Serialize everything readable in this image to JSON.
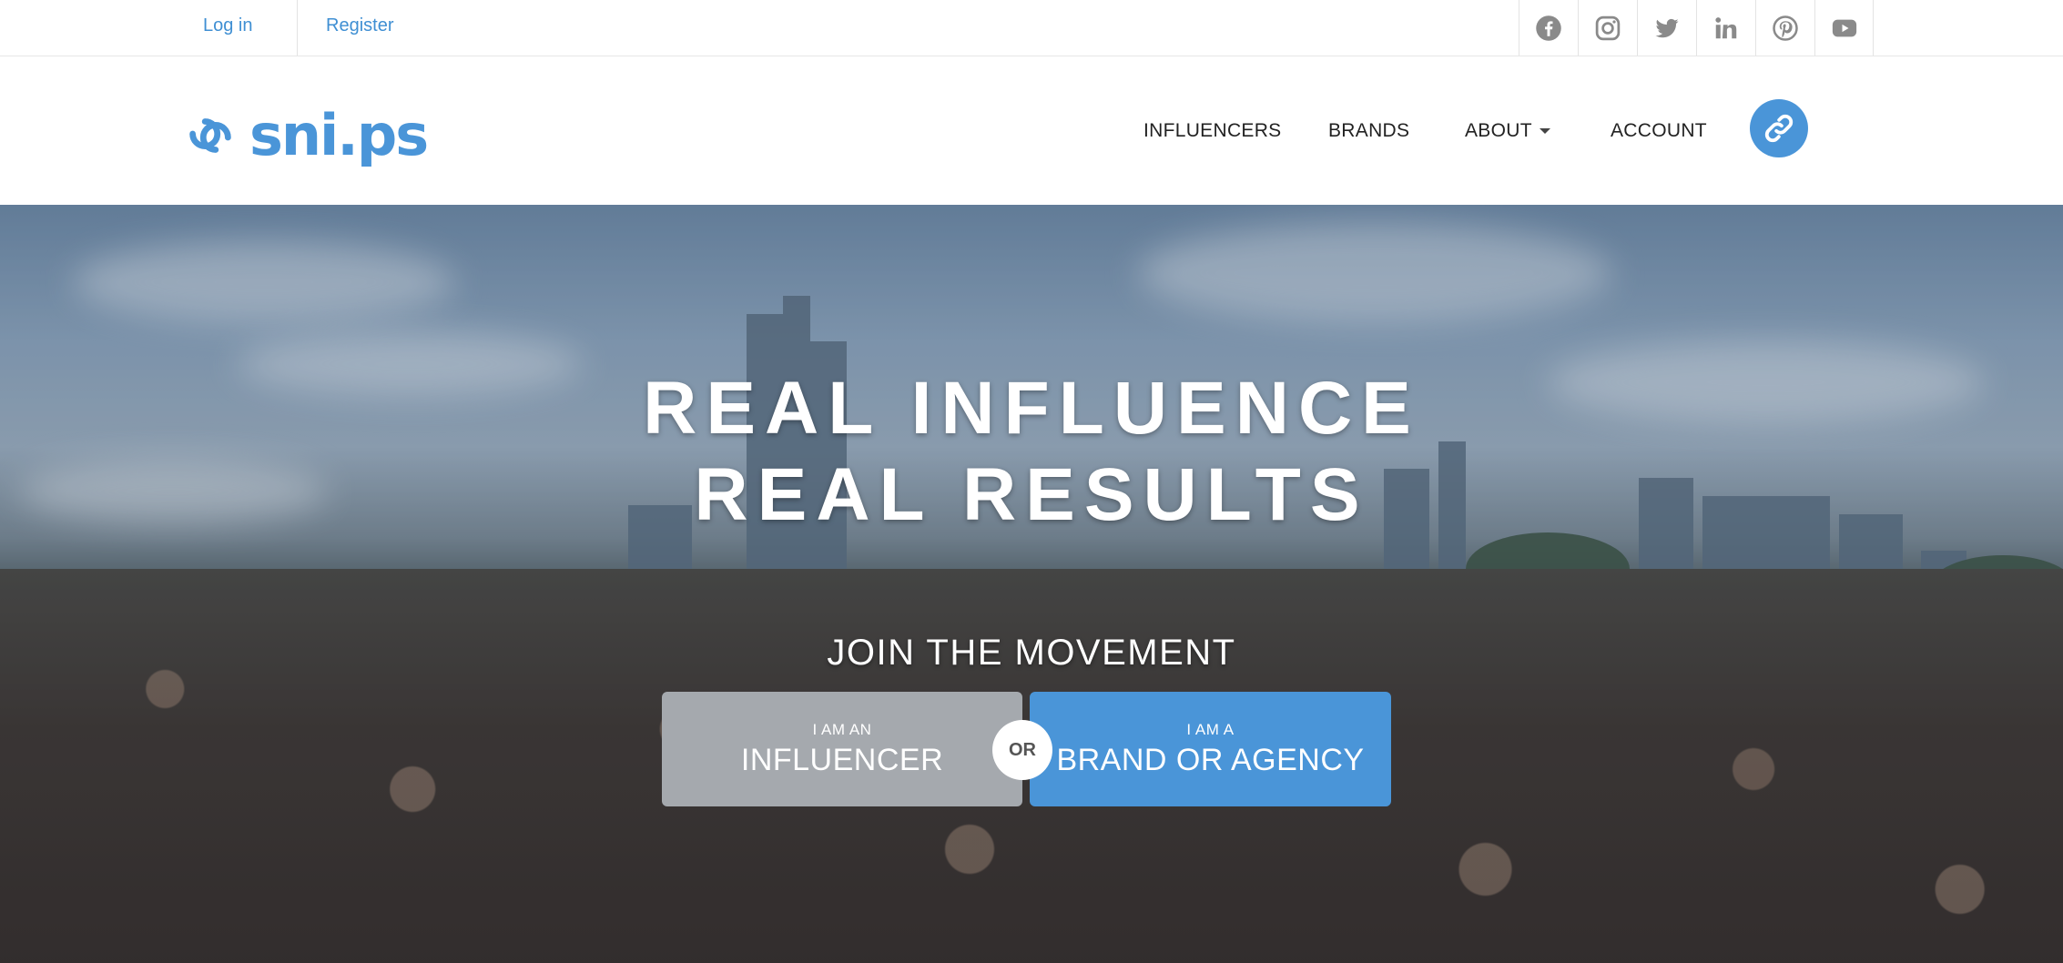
{
  "topbar": {
    "login_label": "Log in",
    "register_label": "Register",
    "social_icons": [
      "facebook-icon",
      "instagram-icon",
      "twitter-icon",
      "linkedin-icon",
      "pinterest-icon",
      "youtube-icon"
    ],
    "icon_color": "#8a8a8a"
  },
  "header": {
    "logo_text": "sni.ps",
    "brand_color": "#4a95d8",
    "nav": {
      "influencers": "INFLUENCERS",
      "brands": "BRANDS",
      "about": "ABOUT",
      "account": "ACCOUNT"
    },
    "cta_icon": "link-icon"
  },
  "hero": {
    "title_line1": "REAL INFLUENCE",
    "title_line2": "REAL RESULTS",
    "subtitle": "JOIN THE MOVEMENT",
    "influencer_small": "I AM AN",
    "influencer_big": "INFLUENCER",
    "or_label": "OR",
    "brand_small": "I AM A",
    "brand_big": "BRAND OR AGENCY",
    "influencer_color": "#a5a9ae",
    "brand_color": "#4a95d8"
  }
}
